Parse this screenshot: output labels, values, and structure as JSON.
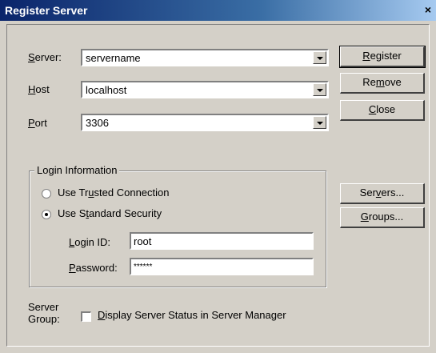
{
  "window": {
    "title": "Register Server",
    "close_glyph": "×"
  },
  "fields": {
    "server": {
      "label_u": "S",
      "label_rest": "erver:",
      "value": "servername"
    },
    "host": {
      "label_u": "H",
      "label_rest": "ost",
      "value": "localhost"
    },
    "port": {
      "label_u": "P",
      "label_rest": "ort",
      "value": "3306"
    }
  },
  "buttons": {
    "register": {
      "u": "R",
      "rest": "egister"
    },
    "remove": {
      "pre": "Re",
      "u": "m",
      "rest": "ove"
    },
    "close": {
      "u": "C",
      "rest": "lose"
    },
    "servers": {
      "pre": "Ser",
      "u": "v",
      "rest": "ers..."
    },
    "groups": {
      "u": "G",
      "rest": "roups..."
    }
  },
  "login": {
    "legend": "Login Information",
    "trusted": {
      "pre": "Use Tr",
      "u": "u",
      "rest": "sted Connection",
      "selected": false
    },
    "standard": {
      "pre": "Use S",
      "u": "t",
      "rest": "andard Security",
      "selected": true
    },
    "login_id": {
      "u": "L",
      "rest": "ogin ID:",
      "value": "root"
    },
    "password": {
      "u": "P",
      "rest": "assword:",
      "value": "******"
    }
  },
  "server_group": {
    "label_line1": "Server",
    "label_line2": "Group:",
    "checkbox": {
      "u": "D",
      "rest": "isplay Server Status in Server Manager",
      "checked": false
    }
  }
}
